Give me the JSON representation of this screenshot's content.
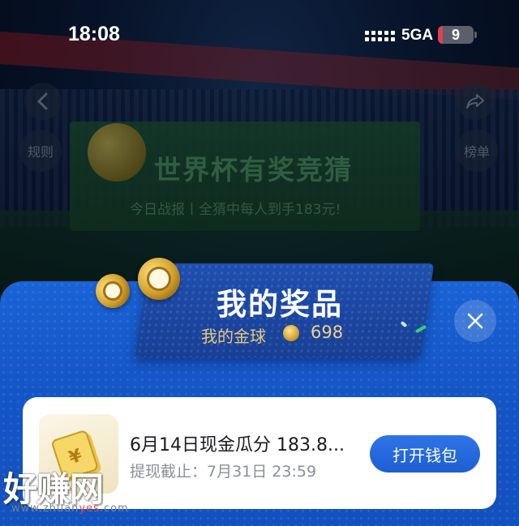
{
  "status_bar": {
    "time": "18:08",
    "network": "5GA",
    "battery_level": "9"
  },
  "background": {
    "banner_title": "世界杯有奖竞猜",
    "banner_subtitle": "今日战报丨全猜中每人到手183元!",
    "left_button_label": "规则",
    "right_button_label": "榜单"
  },
  "sheet": {
    "title": "我的奖品",
    "gold_label": "我的金球",
    "gold_count": "698",
    "close_icon": "close-icon"
  },
  "prize": {
    "title": "6月14日现金瓜分 183.8...",
    "deadline": "提现截止：7月31日 23:59",
    "button_label": "打开钱包",
    "thumb_icon": "cash-icon"
  },
  "watermark": {
    "main": "好赚网",
    "url_prefix": "www.zhuan",
    "url_highlight": "yes",
    "url_suffix": ".com"
  },
  "colors": {
    "sheet_blue": "#1a63d6",
    "button_blue": "#1e5fd4",
    "gold": "#e9c97a"
  }
}
